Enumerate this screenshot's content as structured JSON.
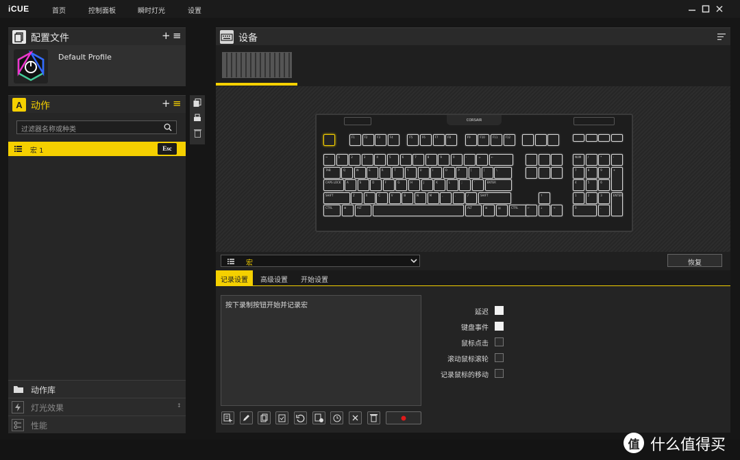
{
  "app": {
    "title": "iCUE"
  },
  "nav": [
    {
      "label": "首页"
    },
    {
      "label": "控制面板"
    },
    {
      "label": "瞬时灯光"
    },
    {
      "label": "设置"
    }
  ],
  "profile": {
    "title": "配置文件",
    "name": "Default Profile",
    "add": "+",
    "menu": "≡"
  },
  "actions": {
    "title": "动作",
    "add": "+",
    "menu": "≡",
    "filter_placeholder": "过滤器名称或种类",
    "item_label": "宏 1",
    "item_key": "Esc"
  },
  "bottom": [
    {
      "label": "动作库"
    },
    {
      "label": "灯光效果",
      "extra": "↕"
    },
    {
      "label": "性能"
    }
  ],
  "device": {
    "title": "设备"
  },
  "macro_bar": {
    "type": "宏",
    "restore": "恢复"
  },
  "tabs": [
    {
      "label": "记录设置"
    },
    {
      "label": "高级设置"
    },
    {
      "label": "开始设置"
    }
  ],
  "record": {
    "hint": "按下录制按钮开始并记录宏"
  },
  "options": [
    {
      "label": "延迟",
      "checked": true
    },
    {
      "label": "键盘事件",
      "checked": true
    },
    {
      "label": "鼠标点击",
      "checked": false
    },
    {
      "label": "滚动鼠标滚轮",
      "checked": false
    },
    {
      "label": "记录鼠标的移动",
      "checked": false
    }
  ],
  "watermark": {
    "text": "什么值得买",
    "badge": "值"
  },
  "keyboard": {
    "brand": "CORSAIR",
    "row1": [
      "F1",
      "F2",
      "F3",
      "F4",
      "F5",
      "F6",
      "F7",
      "F8",
      "F9",
      "F10",
      "F11",
      "F12"
    ],
    "row2": [
      "~",
      "1",
      "2",
      "3",
      "4",
      "5",
      "6",
      "7",
      "8",
      "9",
      "0",
      "-",
      "=",
      "←"
    ],
    "row3": [
      "TAB",
      "Q",
      "W",
      "E",
      "R",
      "T",
      "Y",
      "U",
      "I",
      "O",
      "P",
      "[",
      "]",
      "\\"
    ],
    "row4": [
      "CAPS LOCK",
      "A",
      "S",
      "D",
      "F",
      "G",
      "H",
      "J",
      "K",
      "L",
      ";",
      "'",
      "ENTER"
    ],
    "row5": [
      "SHIFT",
      "Z",
      "X",
      "C",
      "V",
      "B",
      "N",
      "M",
      ",",
      ".",
      "/",
      "SHIFT"
    ],
    "row6": [
      "CTRL",
      "⊞",
      "ALT",
      "",
      "ALT",
      "⊞",
      "▤",
      "CTRL"
    ],
    "nav": [
      "↑",
      "←",
      "↓",
      "→"
    ],
    "numpad": [
      "NUM",
      "/",
      "*",
      "-",
      "7",
      "8",
      "9",
      "+",
      "4",
      "5",
      "6",
      "1",
      "2",
      "3",
      "ENTER",
      "0",
      "."
    ]
  }
}
